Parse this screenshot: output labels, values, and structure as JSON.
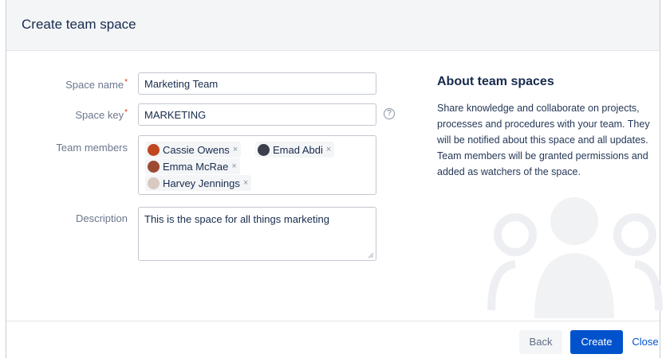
{
  "dialog": {
    "title": "Create team space"
  },
  "form": {
    "space_name_label": "Space name",
    "space_name_value": "Marketing Team",
    "space_key_label": "Space key",
    "space_key_value": "MARKETING",
    "required_mark": "*",
    "help_icon": "?",
    "team_members_label": "Team members",
    "team_members": [
      {
        "name": "Cassie Owens",
        "remove": "×",
        "avatar_color": "#c0471f"
      },
      {
        "name": "Emad Abdi",
        "remove": "×",
        "avatar_color": "#3a3f4b"
      },
      {
        "name": "Emma McRae",
        "remove": "×",
        "avatar_color": "#9b4a34"
      },
      {
        "name": "Harvey Jennings",
        "remove": "×",
        "avatar_color": "#d8c9c1"
      }
    ],
    "description_label": "Description",
    "description_value": "This is the space for all things marketing"
  },
  "sidebar": {
    "title": "About team spaces",
    "text": "Share knowledge and collaborate on projects, processes and procedures with your team. They will be notified about this space and all updates. Team members will be granted permissions and added as watchers of the space."
  },
  "footer": {
    "back_label": "Back",
    "create_label": "Create",
    "close_label": "Close"
  },
  "colors": {
    "primary": "#0052cc",
    "required": "#de350b",
    "header_bg": "#f4f5f7"
  }
}
